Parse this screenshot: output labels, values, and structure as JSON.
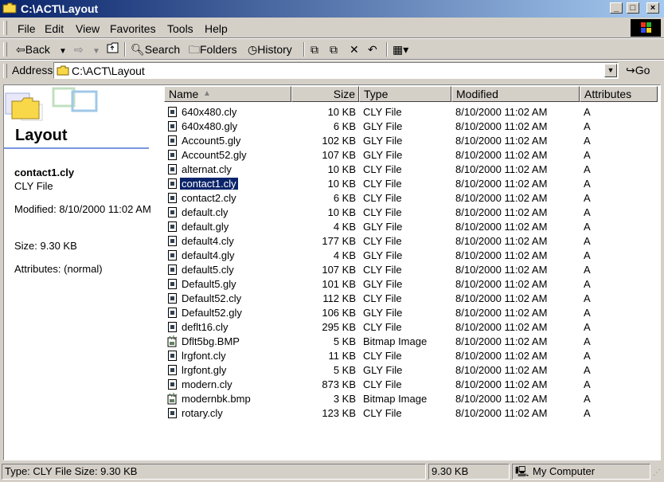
{
  "window": {
    "title": "C:\\ACT\\Layout"
  },
  "menu": [
    "File",
    "Edit",
    "View",
    "Favorites",
    "Tools",
    "Help"
  ],
  "toolbar": {
    "back": "Back",
    "search": "Search",
    "folders": "Folders",
    "history": "History"
  },
  "address": {
    "label": "Address",
    "path": "C:\\ACT\\Layout",
    "go": "Go"
  },
  "leftpane": {
    "title": "Layout",
    "selected_name": "contact1.cly",
    "selected_type": "CLY File",
    "modified": "Modified: 8/10/2000 11:02 AM",
    "size": "Size: 9.30 KB",
    "attributes": "Attributes: (normal)"
  },
  "columns": {
    "name": "Name",
    "size": "Size",
    "type": "Type",
    "modified": "Modified",
    "attributes": "Attributes"
  },
  "files": [
    {
      "name": "640x480.cly",
      "size": "10 KB",
      "type": "CLY File",
      "modified": "8/10/2000 11:02 AM",
      "attr": "A",
      "icon": "document-icon"
    },
    {
      "name": "640x480.gly",
      "size": "6 KB",
      "type": "GLY File",
      "modified": "8/10/2000 11:02 AM",
      "attr": "A",
      "icon": "document-icon"
    },
    {
      "name": "Account5.gly",
      "size": "102 KB",
      "type": "GLY File",
      "modified": "8/10/2000 11:02 AM",
      "attr": "A",
      "icon": "document-icon"
    },
    {
      "name": "Account52.gly",
      "size": "107 KB",
      "type": "GLY File",
      "modified": "8/10/2000 11:02 AM",
      "attr": "A",
      "icon": "document-icon"
    },
    {
      "name": "alternat.cly",
      "size": "10 KB",
      "type": "CLY File",
      "modified": "8/10/2000 11:02 AM",
      "attr": "A",
      "icon": "document-icon"
    },
    {
      "name": "contact1.cly",
      "size": "10 KB",
      "type": "CLY File",
      "modified": "8/10/2000 11:02 AM",
      "attr": "A",
      "icon": "document-icon",
      "selected": true
    },
    {
      "name": "contact2.cly",
      "size": "6 KB",
      "type": "CLY File",
      "modified": "8/10/2000 11:02 AM",
      "attr": "A",
      "icon": "document-icon"
    },
    {
      "name": "default.cly",
      "size": "10 KB",
      "type": "CLY File",
      "modified": "8/10/2000 11:02 AM",
      "attr": "A",
      "icon": "document-icon"
    },
    {
      "name": "default.gly",
      "size": "4 KB",
      "type": "GLY File",
      "modified": "8/10/2000 11:02 AM",
      "attr": "A",
      "icon": "document-icon"
    },
    {
      "name": "default4.cly",
      "size": "177 KB",
      "type": "CLY File",
      "modified": "8/10/2000 11:02 AM",
      "attr": "A",
      "icon": "document-icon"
    },
    {
      "name": "default4.gly",
      "size": "4 KB",
      "type": "GLY File",
      "modified": "8/10/2000 11:02 AM",
      "attr": "A",
      "icon": "document-icon"
    },
    {
      "name": "default5.cly",
      "size": "107 KB",
      "type": "CLY File",
      "modified": "8/10/2000 11:02 AM",
      "attr": "A",
      "icon": "document-icon"
    },
    {
      "name": "Default5.gly",
      "size": "101 KB",
      "type": "GLY File",
      "modified": "8/10/2000 11:02 AM",
      "attr": "A",
      "icon": "document-icon"
    },
    {
      "name": "Default52.cly",
      "size": "112 KB",
      "type": "CLY File",
      "modified": "8/10/2000 11:02 AM",
      "attr": "A",
      "icon": "document-icon"
    },
    {
      "name": "Default52.gly",
      "size": "106 KB",
      "type": "GLY File",
      "modified": "8/10/2000 11:02 AM",
      "attr": "A",
      "icon": "document-icon"
    },
    {
      "name": "deflt16.cly",
      "size": "295 KB",
      "type": "CLY File",
      "modified": "8/10/2000 11:02 AM",
      "attr": "A",
      "icon": "document-icon"
    },
    {
      "name": "Dflt5bg.BMP",
      "size": "5 KB",
      "type": "Bitmap Image",
      "modified": "8/10/2000 11:02 AM",
      "attr": "A",
      "icon": "bitmap-icon"
    },
    {
      "name": "lrgfont.cly",
      "size": "11 KB",
      "type": "CLY File",
      "modified": "8/10/2000 11:02 AM",
      "attr": "A",
      "icon": "document-icon"
    },
    {
      "name": "lrgfont.gly",
      "size": "5 KB",
      "type": "GLY File",
      "modified": "8/10/2000 11:02 AM",
      "attr": "A",
      "icon": "document-icon"
    },
    {
      "name": "modern.cly",
      "size": "873 KB",
      "type": "CLY File",
      "modified": "8/10/2000 11:02 AM",
      "attr": "A",
      "icon": "document-icon"
    },
    {
      "name": "modernbk.bmp",
      "size": "3 KB",
      "type": "Bitmap Image",
      "modified": "8/10/2000 11:02 AM",
      "attr": "A",
      "icon": "bitmap-icon"
    },
    {
      "name": "rotary.cly",
      "size": "123 KB",
      "type": "CLY File",
      "modified": "8/10/2000 11:02 AM",
      "attr": "A",
      "icon": "document-icon"
    }
  ],
  "status": {
    "left": "Type: CLY File Size: 9.30 KB",
    "size": "9.30 KB",
    "zone": "My Computer"
  },
  "colors": {
    "title_start": "#0a246a",
    "title_end": "#a6caf0",
    "selection": "#0a246a",
    "chrome": "#d4d0c8"
  }
}
